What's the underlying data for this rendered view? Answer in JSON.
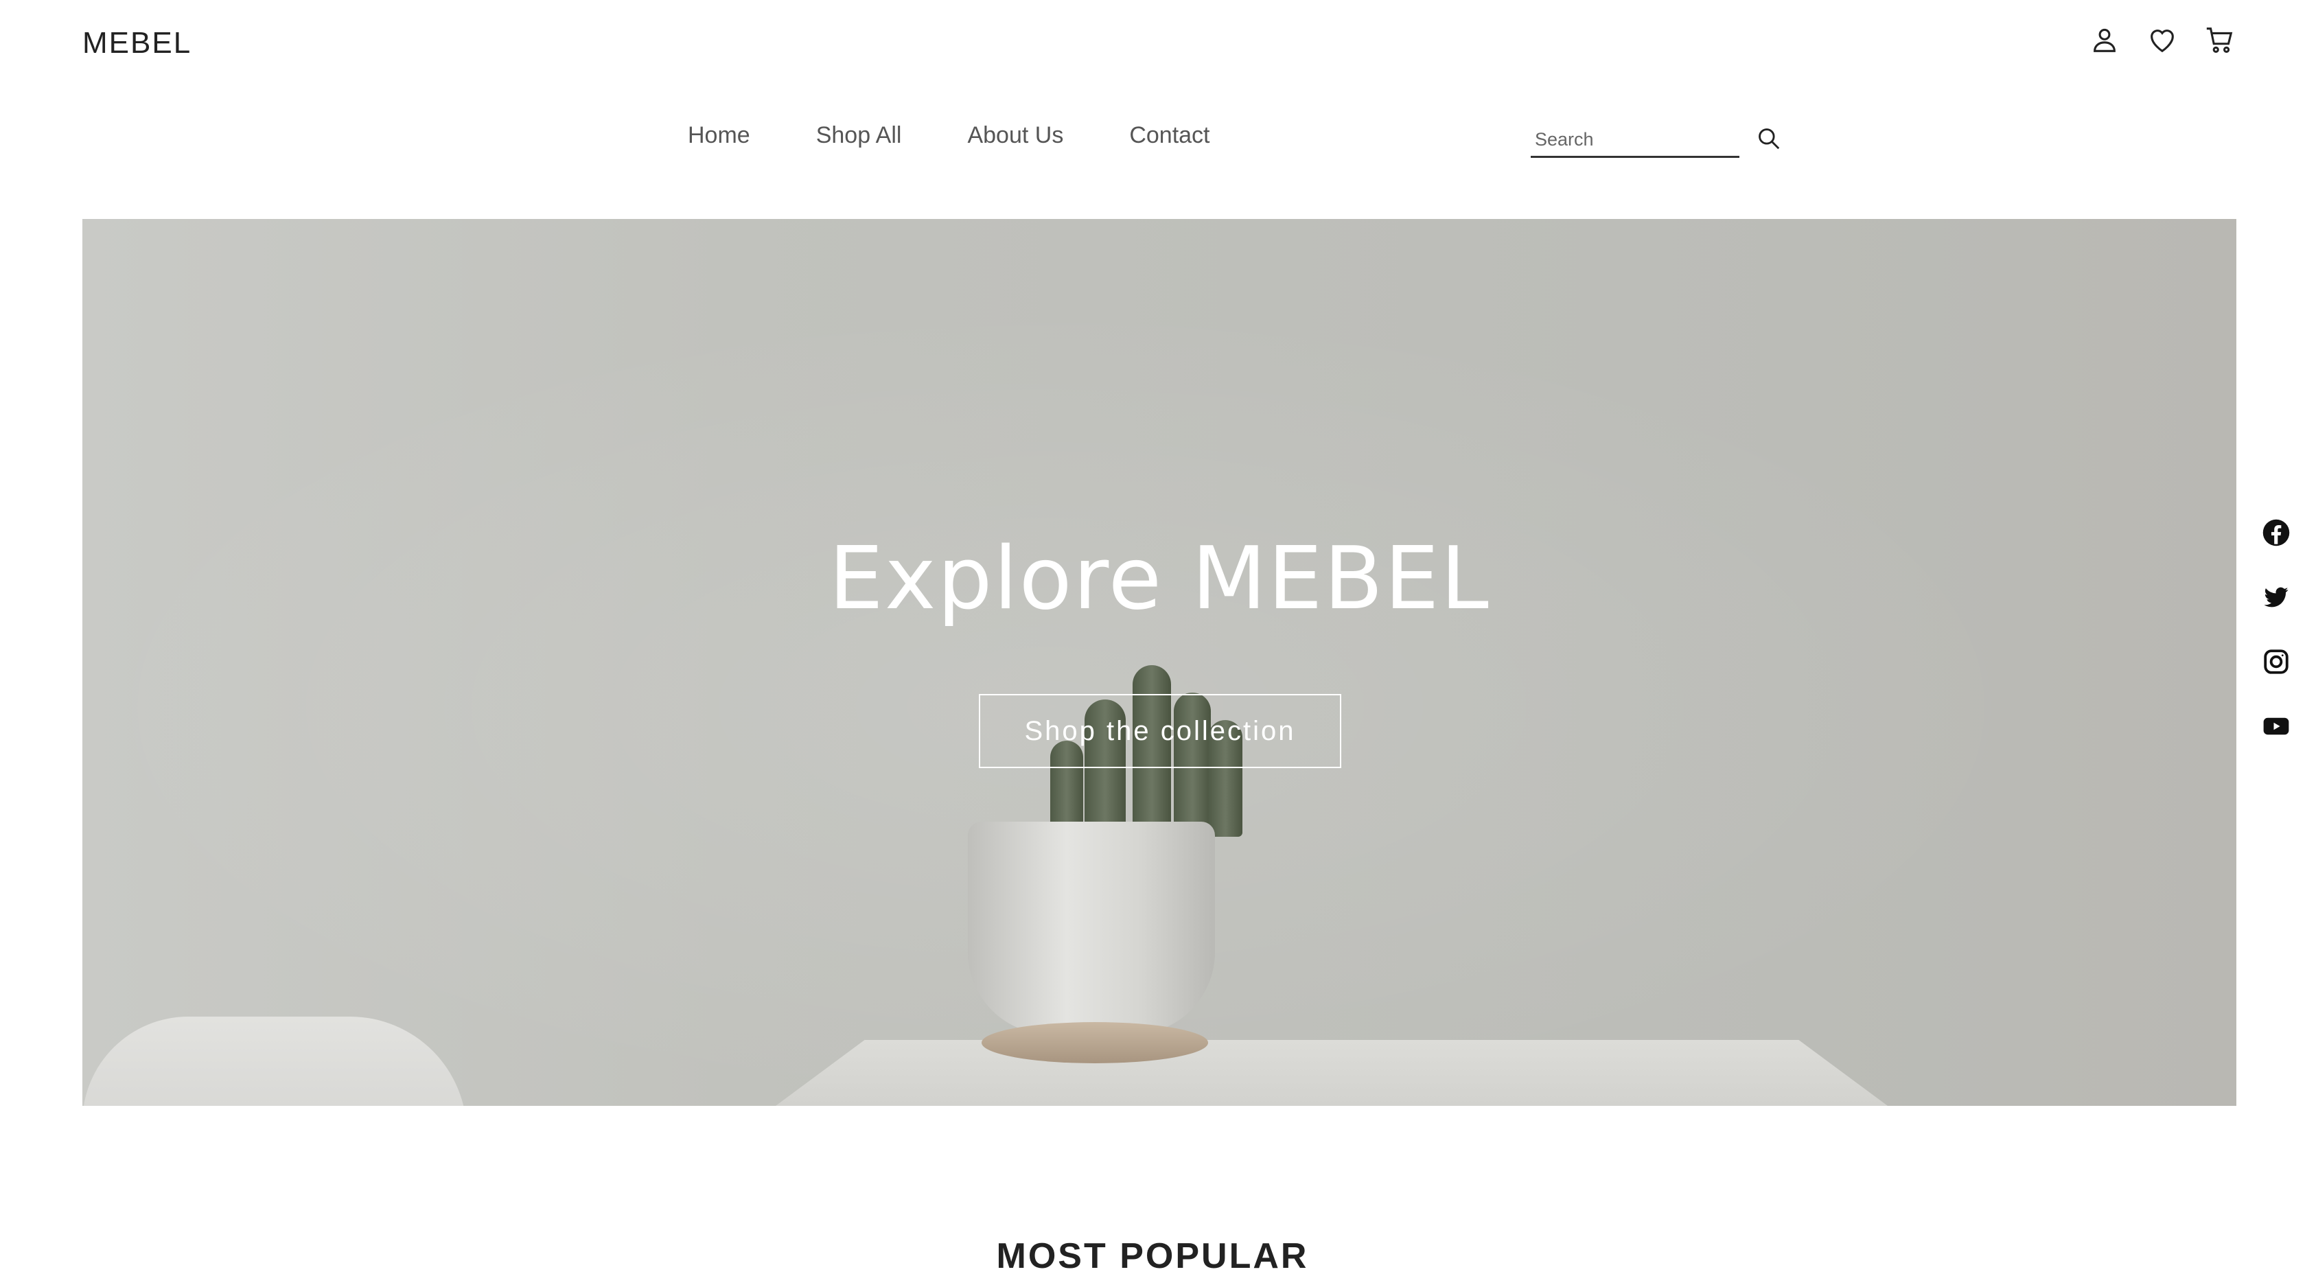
{
  "brand": {
    "logo": "MEBEL"
  },
  "header": {
    "icons": [
      "user-icon",
      "heart-icon",
      "cart-icon"
    ]
  },
  "nav": {
    "items": [
      {
        "label": "Home"
      },
      {
        "label": "Shop All"
      },
      {
        "label": "About Us"
      },
      {
        "label": "Contact"
      }
    ]
  },
  "search": {
    "placeholder": "Search",
    "value": "",
    "icon": "search-icon"
  },
  "hero": {
    "title": "Explore MEBEL",
    "cta_label": "Shop the collection"
  },
  "social": [
    "facebook-icon",
    "twitter-icon",
    "instagram-icon",
    "youtube-icon"
  ],
  "sections": {
    "most_popular_title": "MOST POPULAR"
  },
  "colors": {
    "text": "#222222",
    "nav_text": "#555555",
    "hero_text": "#ffffff"
  }
}
